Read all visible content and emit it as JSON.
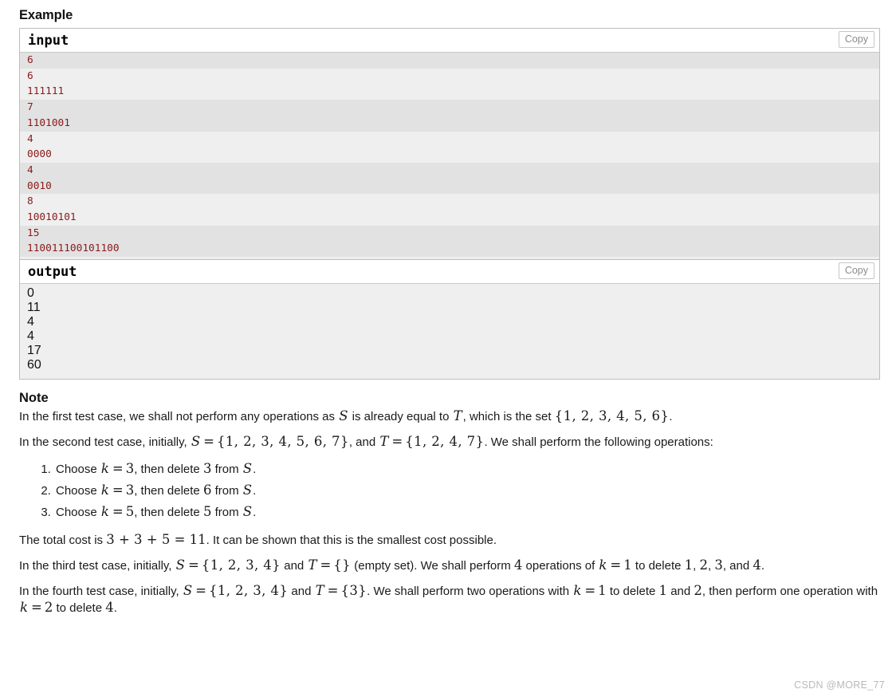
{
  "example": {
    "heading": "Example",
    "input": {
      "label": "input",
      "copy_label": "Copy",
      "groups": [
        {
          "shade": "dark",
          "lines": [
            "6"
          ]
        },
        {
          "shade": "light",
          "lines": [
            "6",
            "111111"
          ]
        },
        {
          "shade": "dark",
          "lines": [
            "7",
            "1101001"
          ]
        },
        {
          "shade": "light",
          "lines": [
            "4",
            "0000"
          ]
        },
        {
          "shade": "dark",
          "lines": [
            "4",
            "0010"
          ]
        },
        {
          "shade": "light",
          "lines": [
            "8",
            "10010101"
          ]
        },
        {
          "shade": "dark",
          "lines": [
            "15",
            "110011100101100"
          ]
        }
      ]
    },
    "output": {
      "label": "output",
      "copy_label": "Copy",
      "lines": [
        "0",
        "11",
        "4",
        "4",
        "17",
        "60"
      ]
    }
  },
  "note": {
    "heading": "Note",
    "p1": {
      "t1": "In the first test case, we shall not perform any operations as ",
      "S": "S",
      "t2": " is already equal to ",
      "T": "T",
      "t3": ", which is the set ",
      "set": "{1, 2, 3, 4, 5, 6}",
      "t4": "."
    },
    "p2": {
      "t1": "In the second test case, initially, ",
      "S": "S",
      "eq1": "=",
      "setS": "{1, 2, 3, 4, 5, 6, 7}",
      "t2": ", and ",
      "T": "T",
      "eq2": "=",
      "setT": "{1, 2, 4, 7}",
      "t3": ". We shall perform the following operations:"
    },
    "operations": [
      {
        "pre": "Choose ",
        "k": "k",
        "eq": "=",
        "kval": "3",
        "mid": ", then delete ",
        "val": "3",
        "post": " from ",
        "S": "S",
        "end": "."
      },
      {
        "pre": "Choose ",
        "k": "k",
        "eq": "=",
        "kval": "3",
        "mid": ", then delete ",
        "val": "6",
        "post": " from ",
        "S": "S",
        "end": "."
      },
      {
        "pre": "Choose ",
        "k": "k",
        "eq": "=",
        "kval": "5",
        "mid": ", then delete ",
        "val": "5",
        "post": " from ",
        "S": "S",
        "end": "."
      }
    ],
    "p3": {
      "t1": "The total cost is ",
      "expr": "3 + 3 + 5 = 11",
      "t2": ". It can be shown that this is the smallest cost possible."
    },
    "p4": {
      "t1": "In the third test case, initially, ",
      "S": "S",
      "eq1": "=",
      "setS": "{1, 2, 3, 4}",
      "t2": " and ",
      "T": "T",
      "eq2": "=",
      "setT": "{}",
      "t3": " (empty set). We shall perform ",
      "n": "4",
      "t4": " operations of ",
      "k": "k",
      "eq3": "=",
      "kval": "1",
      "t5": " to delete ",
      "v1": "1",
      "c1": ", ",
      "v2": "2",
      "c2": ", ",
      "v3": "3",
      "t6": ", and ",
      "v4": "4",
      "t7": "."
    },
    "p5": {
      "t1": "In the fourth test case, initially, ",
      "S": "S",
      "eq1": "=",
      "setS": "{1, 2, 3, 4}",
      "t2": " and ",
      "T": "T",
      "eq2": "=",
      "setT": "{3}",
      "t3": ". We shall perform two operations with ",
      "k": "k",
      "eq3": "=",
      "kval": "1",
      "t4": " to delete ",
      "v1": "1",
      "t5": " and ",
      "v2": "2",
      "t6": ", then perform one operation with ",
      "k2": "k",
      "eq4": "=",
      "kval2": "2",
      "t7": " to delete ",
      "v3": "4",
      "t8": "."
    }
  },
  "watermark": "CSDN @MORE_77"
}
